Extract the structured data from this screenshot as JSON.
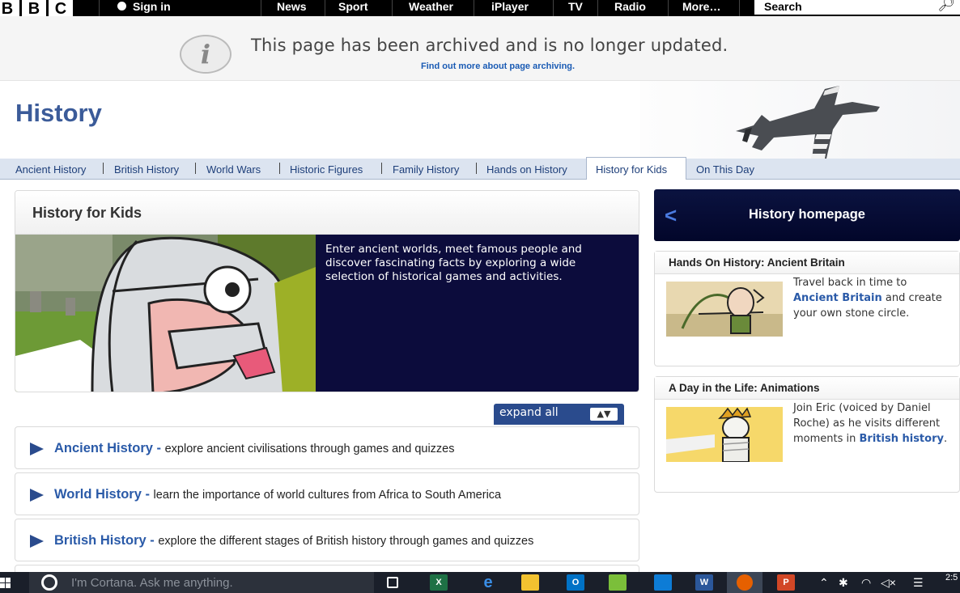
{
  "topbar": {
    "logo": [
      "B",
      "B",
      "C"
    ],
    "signin": "Sign in",
    "nav": [
      "News",
      "Sport",
      "Weather",
      "iPlayer",
      "TV",
      "Radio",
      "More…"
    ],
    "search_placeholder": "Search"
  },
  "archive": {
    "message": "This page has been archived and is no longer updated.",
    "link": "Find out more about page archiving."
  },
  "page_title": "History",
  "tabs": [
    "Ancient History",
    "British History",
    "World Wars",
    "Historic Figures",
    "Family History",
    "Hands on History",
    "History for Kids",
    "On This Day"
  ],
  "active_tab": "History for Kids",
  "feature": {
    "heading": "History for Kids",
    "description": "Enter ancient worlds, meet famous people and discover fascinating facts by exploring a wide selection of historical games and activities."
  },
  "expand_label": "expand all",
  "sections": [
    {
      "title": "Ancient History",
      "dash": " - ",
      "text": "explore ancient civilisations through games and quizzes"
    },
    {
      "title": "World History",
      "dash": " - ",
      "text": "learn the importance of world cultures from Africa to South America"
    },
    {
      "title": "British History",
      "dash": " - ",
      "text": "explore the different stages of British history through games and quizzes"
    }
  ],
  "sidebar": {
    "home_button": "History homepage",
    "cards": [
      {
        "heading": "Hands On History: Ancient Britain",
        "pre": "Travel back in time to ",
        "link": "Ancient Britain",
        "post": " and create your own stone circle."
      },
      {
        "heading": "A Day in the Life: Animations",
        "pre": "Join Eric (voiced by Daniel Roche) as he visits different moments in ",
        "link": "British history",
        "post": "."
      }
    ]
  },
  "taskbar": {
    "search_placeholder": "I'm Cortana. Ask me anything.",
    "clock": "2:5"
  },
  "colors": {
    "brand": "#3b5b99",
    "link": "#2a5aa8",
    "dark_panel": "#0c0c3c",
    "tab_bar": "#dce4f0"
  }
}
